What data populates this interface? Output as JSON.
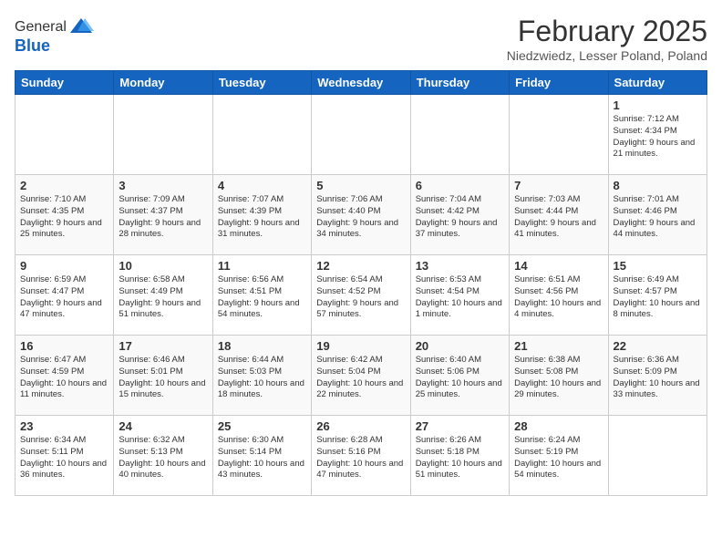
{
  "header": {
    "logo_line1": "General",
    "logo_line2": "Blue",
    "month_year": "February 2025",
    "location": "Niedzwiedz, Lesser Poland, Poland"
  },
  "weekdays": [
    "Sunday",
    "Monday",
    "Tuesday",
    "Wednesday",
    "Thursday",
    "Friday",
    "Saturday"
  ],
  "weeks": [
    [
      {
        "day": "",
        "info": ""
      },
      {
        "day": "",
        "info": ""
      },
      {
        "day": "",
        "info": ""
      },
      {
        "day": "",
        "info": ""
      },
      {
        "day": "",
        "info": ""
      },
      {
        "day": "",
        "info": ""
      },
      {
        "day": "1",
        "info": "Sunrise: 7:12 AM\nSunset: 4:34 PM\nDaylight: 9 hours and 21 minutes."
      }
    ],
    [
      {
        "day": "2",
        "info": "Sunrise: 7:10 AM\nSunset: 4:35 PM\nDaylight: 9 hours and 25 minutes."
      },
      {
        "day": "3",
        "info": "Sunrise: 7:09 AM\nSunset: 4:37 PM\nDaylight: 9 hours and 28 minutes."
      },
      {
        "day": "4",
        "info": "Sunrise: 7:07 AM\nSunset: 4:39 PM\nDaylight: 9 hours and 31 minutes."
      },
      {
        "day": "5",
        "info": "Sunrise: 7:06 AM\nSunset: 4:40 PM\nDaylight: 9 hours and 34 minutes."
      },
      {
        "day": "6",
        "info": "Sunrise: 7:04 AM\nSunset: 4:42 PM\nDaylight: 9 hours and 37 minutes."
      },
      {
        "day": "7",
        "info": "Sunrise: 7:03 AM\nSunset: 4:44 PM\nDaylight: 9 hours and 41 minutes."
      },
      {
        "day": "8",
        "info": "Sunrise: 7:01 AM\nSunset: 4:46 PM\nDaylight: 9 hours and 44 minutes."
      }
    ],
    [
      {
        "day": "9",
        "info": "Sunrise: 6:59 AM\nSunset: 4:47 PM\nDaylight: 9 hours and 47 minutes."
      },
      {
        "day": "10",
        "info": "Sunrise: 6:58 AM\nSunset: 4:49 PM\nDaylight: 9 hours and 51 minutes."
      },
      {
        "day": "11",
        "info": "Sunrise: 6:56 AM\nSunset: 4:51 PM\nDaylight: 9 hours and 54 minutes."
      },
      {
        "day": "12",
        "info": "Sunrise: 6:54 AM\nSunset: 4:52 PM\nDaylight: 9 hours and 57 minutes."
      },
      {
        "day": "13",
        "info": "Sunrise: 6:53 AM\nSunset: 4:54 PM\nDaylight: 10 hours and 1 minute."
      },
      {
        "day": "14",
        "info": "Sunrise: 6:51 AM\nSunset: 4:56 PM\nDaylight: 10 hours and 4 minutes."
      },
      {
        "day": "15",
        "info": "Sunrise: 6:49 AM\nSunset: 4:57 PM\nDaylight: 10 hours and 8 minutes."
      }
    ],
    [
      {
        "day": "16",
        "info": "Sunrise: 6:47 AM\nSunset: 4:59 PM\nDaylight: 10 hours and 11 minutes."
      },
      {
        "day": "17",
        "info": "Sunrise: 6:46 AM\nSunset: 5:01 PM\nDaylight: 10 hours and 15 minutes."
      },
      {
        "day": "18",
        "info": "Sunrise: 6:44 AM\nSunset: 5:03 PM\nDaylight: 10 hours and 18 minutes."
      },
      {
        "day": "19",
        "info": "Sunrise: 6:42 AM\nSunset: 5:04 PM\nDaylight: 10 hours and 22 minutes."
      },
      {
        "day": "20",
        "info": "Sunrise: 6:40 AM\nSunset: 5:06 PM\nDaylight: 10 hours and 25 minutes."
      },
      {
        "day": "21",
        "info": "Sunrise: 6:38 AM\nSunset: 5:08 PM\nDaylight: 10 hours and 29 minutes."
      },
      {
        "day": "22",
        "info": "Sunrise: 6:36 AM\nSunset: 5:09 PM\nDaylight: 10 hours and 33 minutes."
      }
    ],
    [
      {
        "day": "23",
        "info": "Sunrise: 6:34 AM\nSunset: 5:11 PM\nDaylight: 10 hours and 36 minutes."
      },
      {
        "day": "24",
        "info": "Sunrise: 6:32 AM\nSunset: 5:13 PM\nDaylight: 10 hours and 40 minutes."
      },
      {
        "day": "25",
        "info": "Sunrise: 6:30 AM\nSunset: 5:14 PM\nDaylight: 10 hours and 43 minutes."
      },
      {
        "day": "26",
        "info": "Sunrise: 6:28 AM\nSunset: 5:16 PM\nDaylight: 10 hours and 47 minutes."
      },
      {
        "day": "27",
        "info": "Sunrise: 6:26 AM\nSunset: 5:18 PM\nDaylight: 10 hours and 51 minutes."
      },
      {
        "day": "28",
        "info": "Sunrise: 6:24 AM\nSunset: 5:19 PM\nDaylight: 10 hours and 54 minutes."
      },
      {
        "day": "",
        "info": ""
      }
    ]
  ]
}
